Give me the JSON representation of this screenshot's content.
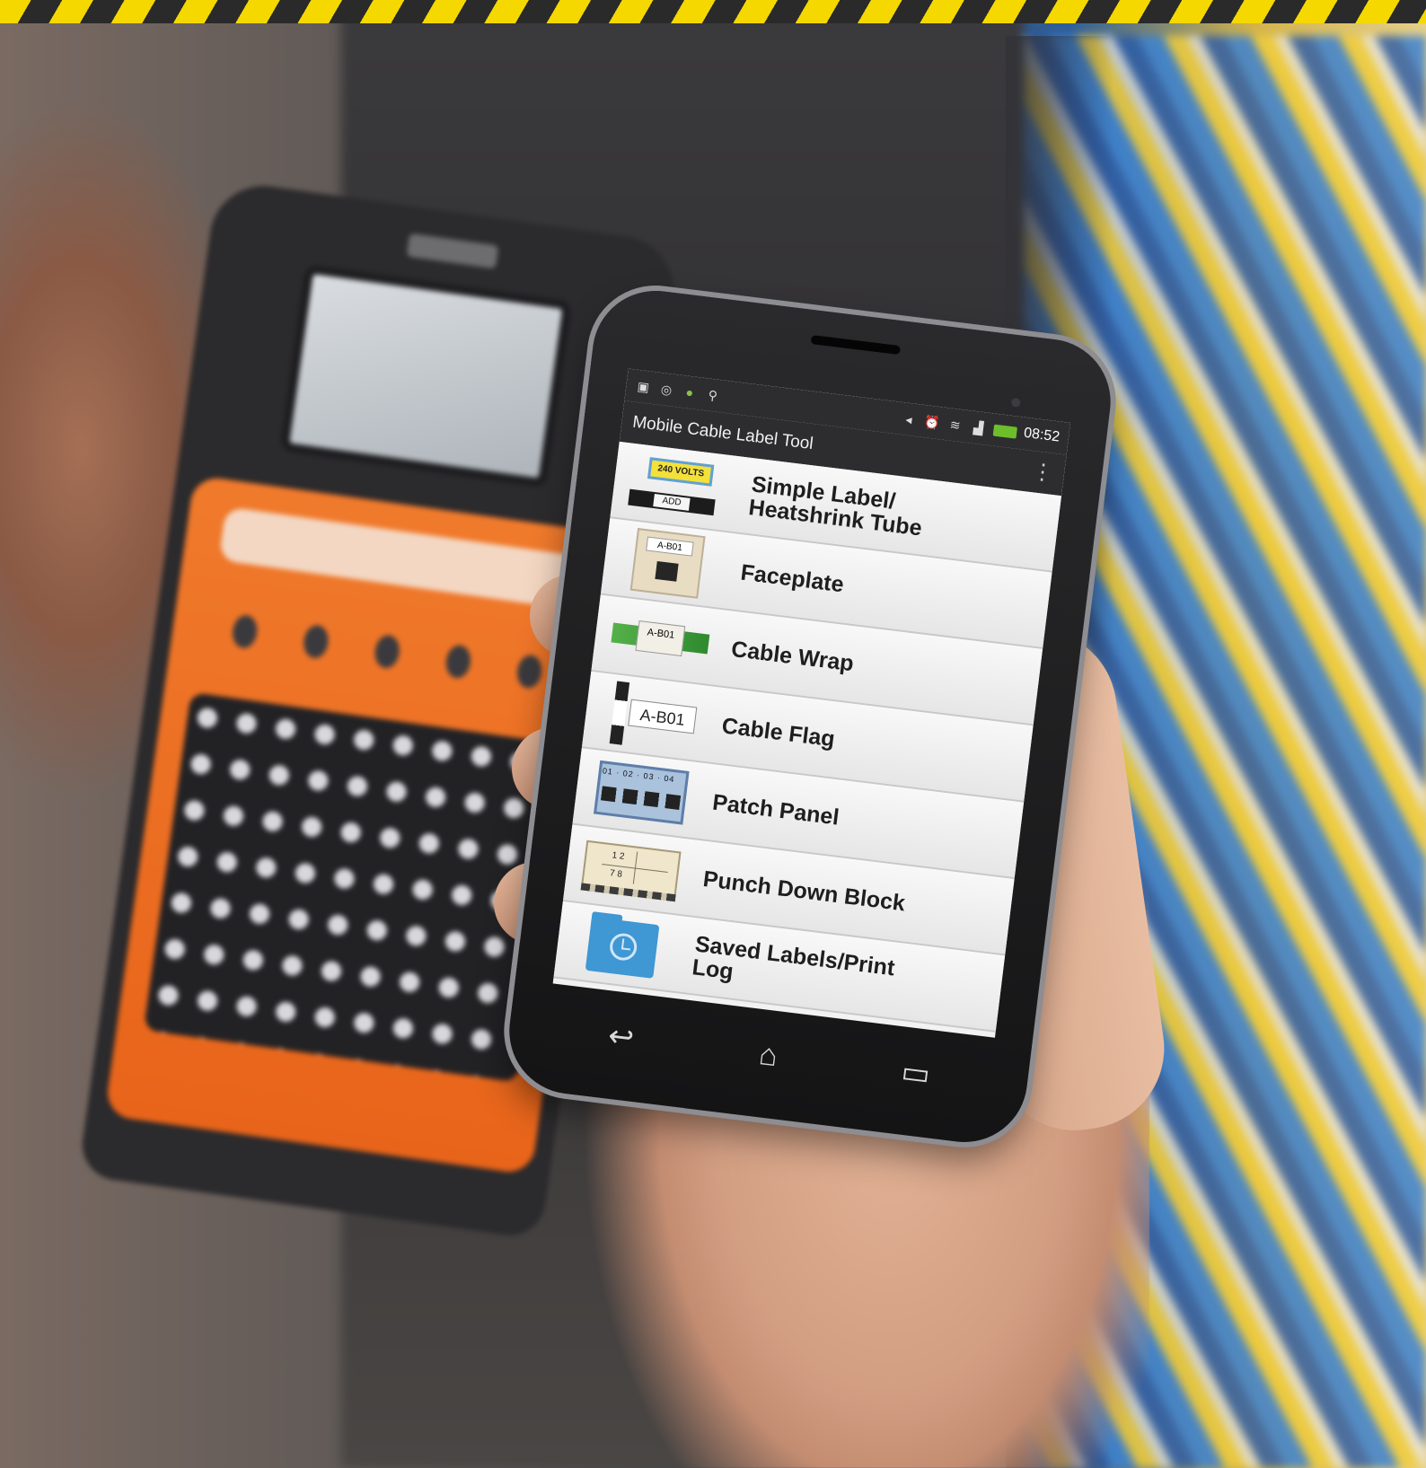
{
  "status_bar": {
    "left_icons": [
      "screenshot-icon",
      "whatsapp-icon",
      "android-icon",
      "usb-icon"
    ],
    "right_icons": [
      "mute-icon",
      "alarm-icon",
      "wifi-icon",
      "signal-icon",
      "battery-icon"
    ],
    "time": "08:52"
  },
  "app": {
    "title": "Mobile Cable Label Tool",
    "overflow_icon": "⋮"
  },
  "menu": [
    {
      "label": "Simple Label/ Heatshrink Tube",
      "thumb": "simple",
      "thumb_text_1": "240 VOLTS",
      "thumb_text_2": "ADD"
    },
    {
      "label": "Faceplate",
      "thumb": "faceplate",
      "thumb_text_1": "A-B01"
    },
    {
      "label": "Cable Wrap",
      "thumb": "wrap",
      "thumb_text_1": "A-B01"
    },
    {
      "label": "Cable Flag",
      "thumb": "flag",
      "thumb_text_1": "A-B01"
    },
    {
      "label": "Patch Panel",
      "thumb": "patch",
      "thumb_text_1": "01 · 02 · 03 · 04"
    },
    {
      "label": "Punch Down Block",
      "thumb": "punch",
      "thumb_text_1": "1 2",
      "thumb_text_2": "7 8"
    },
    {
      "label": "Saved Labels/Print Log",
      "thumb": "saved"
    }
  ],
  "nav": {
    "back": "↩",
    "home": "⌂",
    "recent": "▭"
  },
  "colors": {
    "hazard_yellow": "#f4d800",
    "printer_orange": "#e8641a",
    "folder_blue": "#3f97d3"
  }
}
